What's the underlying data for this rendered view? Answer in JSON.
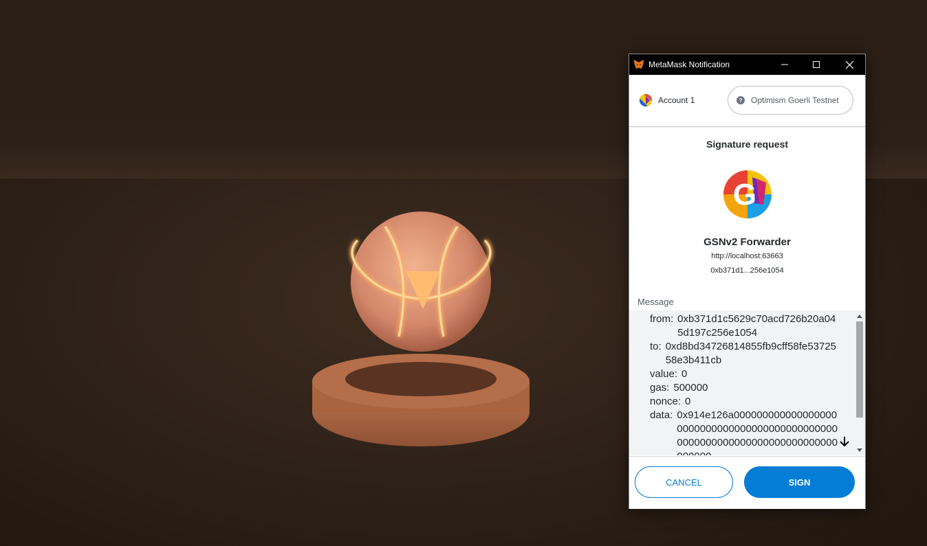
{
  "window": {
    "title": "MetaMask Notification"
  },
  "account": {
    "name": "Account 1"
  },
  "network": {
    "name": "Optimism Goerli Testnet",
    "icon": "question-icon"
  },
  "signature": {
    "title": "Signature request",
    "site_name": "GSNv2 Forwarder",
    "site_url": "http://localhost:63663",
    "site_address": "0xb371d1...256e1054",
    "logo_letter": "G"
  },
  "message": {
    "label": "Message",
    "fields": [
      {
        "key": "from:",
        "value": "0xb371d1c5629c70acd726b20a045d197c256e1054"
      },
      {
        "key": "to:",
        "value": "0xd8bd34726814855fb9cff58fe5372558e3b411cb"
      },
      {
        "key": "value:",
        "value": "0"
      },
      {
        "key": "gas:",
        "value": "500000"
      },
      {
        "key": "nonce:",
        "value": "0"
      },
      {
        "key": "data:",
        "value": "0x914e126a00000000000000000000000000000000000000000000000000000000000000000000000000000000"
      }
    ]
  },
  "buttons": {
    "cancel": "CANCEL",
    "sign": "SIGN"
  },
  "colors": {
    "primary": "#037dd6",
    "titlebar": "#000000"
  }
}
